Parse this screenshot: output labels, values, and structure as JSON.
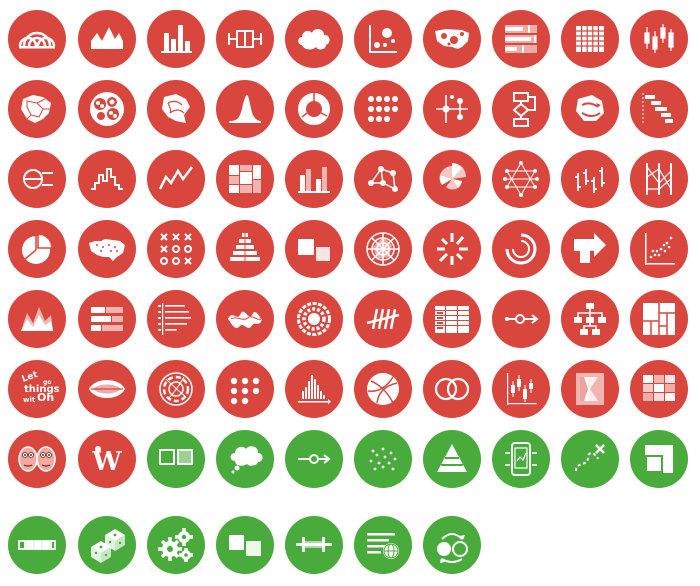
{
  "colors": {
    "red": "#d9463e",
    "green": "#48ab3c",
    "glyph": "#ffffff"
  },
  "rows": [
    {
      "color": "red",
      "icons": [
        "arc-diagram-icon",
        "area-graph-icon",
        "bar-chart-icon",
        "box-and-whisker-plot-icon",
        "brainstorm-cloud-icon",
        "bubble-chart-icon",
        "bubble-map-icon",
        "bullet-graph-icon",
        "calendar-icon",
        "candlestick-chart-icon"
      ]
    },
    {
      "color": "red",
      "icons": [
        "choropleth-map-icon",
        "circle-packing-icon",
        "connection-map-icon",
        "density-plot-icon",
        "donut-chart-icon",
        "dot-matrix-chart-icon",
        "dot-map-icon",
        "flow-chart-icon",
        "flow-map-icon",
        "gantt-chart-icon"
      ]
    },
    {
      "color": "red",
      "icons": [
        "venn-diagram-icon",
        "histogram-icon",
        "line-graph-icon",
        "marimekko-chart-icon",
        "multiset-bar-chart-icon",
        "network-diagram-icon",
        "nightingale-rose-chart-icon",
        "non-ribbon-chord-diagram-icon",
        "open-high-low-close-chart-icon",
        "parallel-coordinates-plot-icon"
      ]
    },
    {
      "color": "red",
      "icons": [
        "pie-chart-icon",
        "point-and-figure-chart-icon",
        "proportional-area-chart-icon",
        "population-pyramid-icon",
        "radar-chart-icon",
        "radial-bar-chart-icon",
        "radial-column-chart-icon",
        "sankey-diagram-icon",
        "scatterplot-icon",
        "span-chart-icon"
      ]
    },
    {
      "color": "red",
      "icons": [
        "spiral-plot-icon",
        "stacked-area-graph-icon",
        "stacked-bar-graph-icon",
        "stem-and-leaf-plot-icon",
        "stream-graph-icon",
        "sunburst-diagram-icon",
        "tally-chart-icon",
        "timeline-icon",
        "timetable-icon",
        "tree-diagram-icon"
      ]
    },
    {
      "color": "red",
      "icons": [
        "treemap-icon",
        "word-cloud-icon",
        "violin-plot-icon",
        "chord-diagram-icon",
        "dot-matrix-chart-icon",
        "histogram-icon",
        "globe-chart-icon",
        "venn-diagram-icon",
        "error-bars-icon",
        "heatmap-icon"
      ]
    },
    {
      "color": "mixed",
      "icons": [
        "chernoff-faces-icon",
        "wikipedia-icon",
        "comparison-icon",
        "thought-cloud-icon",
        "process-arrow-icon",
        "scattered-dots-icon",
        "pyramid-icon",
        "mobile-screen-icon",
        "route-map-icon",
        "expand-box-icon"
      ]
    },
    {
      "color": "green",
      "icons": [
        "sequence-bar-icon",
        "dice-icon",
        "gears-icon",
        "side-by-side-boxes-icon",
        "range-slider-icon",
        "chart-with-globe-icon",
        "cycle-icon"
      ]
    }
  ]
}
